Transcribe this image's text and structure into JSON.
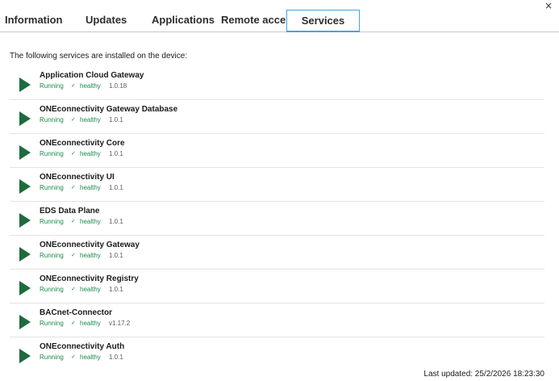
{
  "window": {
    "close_label": "×"
  },
  "tabs": [
    {
      "label": "Information",
      "active": false
    },
    {
      "label": "Updates",
      "active": false
    },
    {
      "label": "Applications",
      "active": false
    },
    {
      "label": "Remote access",
      "active": false
    },
    {
      "label": "Services",
      "active": true
    }
  ],
  "intro_text": "The following services are installed on the device:",
  "services": [
    {
      "name": "Application Cloud Gateway",
      "status": "Running",
      "health": "healthy",
      "version": "1.0.18",
      "icon": "play-icon"
    },
    {
      "name": "ONEconnectivity Gateway Database",
      "status": "Running",
      "health": "healthy",
      "version": "1.0.1",
      "icon": "play-icon"
    },
    {
      "name": "ONEconnectivity Core",
      "status": "Running",
      "health": "healthy",
      "version": "1.0.1",
      "icon": "play-icon"
    },
    {
      "name": "ONEconnectivity UI",
      "status": "Running",
      "health": "healthy",
      "version": "1.0.1",
      "icon": "play-icon"
    },
    {
      "name": "EDS Data Plane",
      "status": "Running",
      "health": "healthy",
      "version": "1.0.1",
      "icon": "play-icon"
    },
    {
      "name": "ONEconnectivity Gateway",
      "status": "Running",
      "health": "healthy",
      "version": "1.0.1",
      "icon": "play-icon"
    },
    {
      "name": "ONEconnectivity Registry",
      "status": "Running",
      "health": "healthy",
      "version": "1.0.1",
      "icon": "play-icon"
    },
    {
      "name": "BACnet-Connector",
      "status": "Running",
      "health": "healthy",
      "version": "v1.17.2",
      "icon": "play-icon"
    },
    {
      "name": "ONEconnectivity Auth",
      "status": "Running",
      "health": "healthy",
      "version": "1.0.1",
      "icon": "play-icon"
    }
  ],
  "check_glyph": "✓",
  "last_updated": "Last updated: 25/2/2026 18:23:30",
  "colors": {
    "accent_tab_border": "#4aa3df",
    "status_green": "#1a8a4a",
    "play_icon_green": "#1e6b3d"
  }
}
